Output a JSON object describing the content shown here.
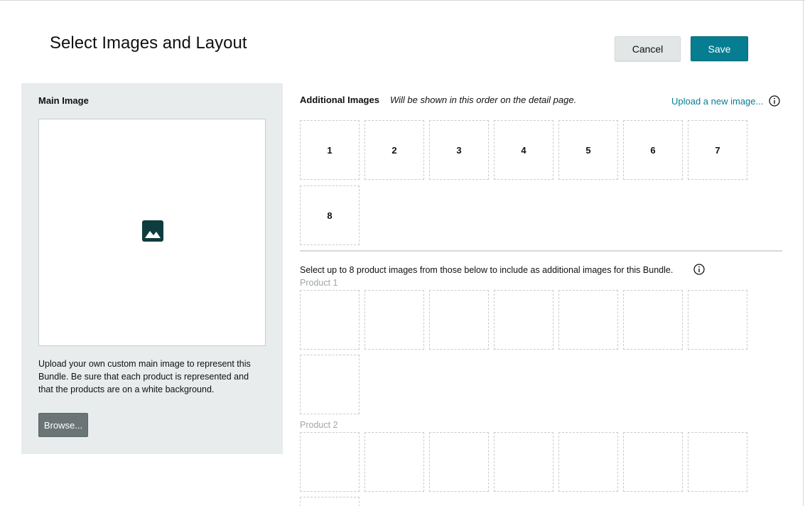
{
  "header": {
    "title": "Select Images and Layout",
    "cancel_label": "Cancel",
    "save_label": "Save"
  },
  "main_image": {
    "heading": "Main Image",
    "help_text": "Upload your own custom main image to represent this Bundle. Be sure that each product is represented and that the products are on a white background.",
    "browse_label": "Browse...",
    "placeholder_icon": "image-placeholder-icon"
  },
  "additional_images": {
    "heading": "Additional Images",
    "note": "Will be shown in this order on the detail page.",
    "upload_link": "Upload a new image...",
    "slots": [
      "1",
      "2",
      "3",
      "4",
      "5",
      "6",
      "7",
      "8"
    ]
  },
  "product_selection": {
    "instruction": "Select up to 8 product images from those below to include as additional images for this Bundle.",
    "products": [
      {
        "label": "Product 1"
      },
      {
        "label": "Product 2"
      }
    ]
  },
  "colors": {
    "accent": "#067d91",
    "panel_bg": "#e9ecec",
    "muted_text": "#a2a6a6"
  }
}
